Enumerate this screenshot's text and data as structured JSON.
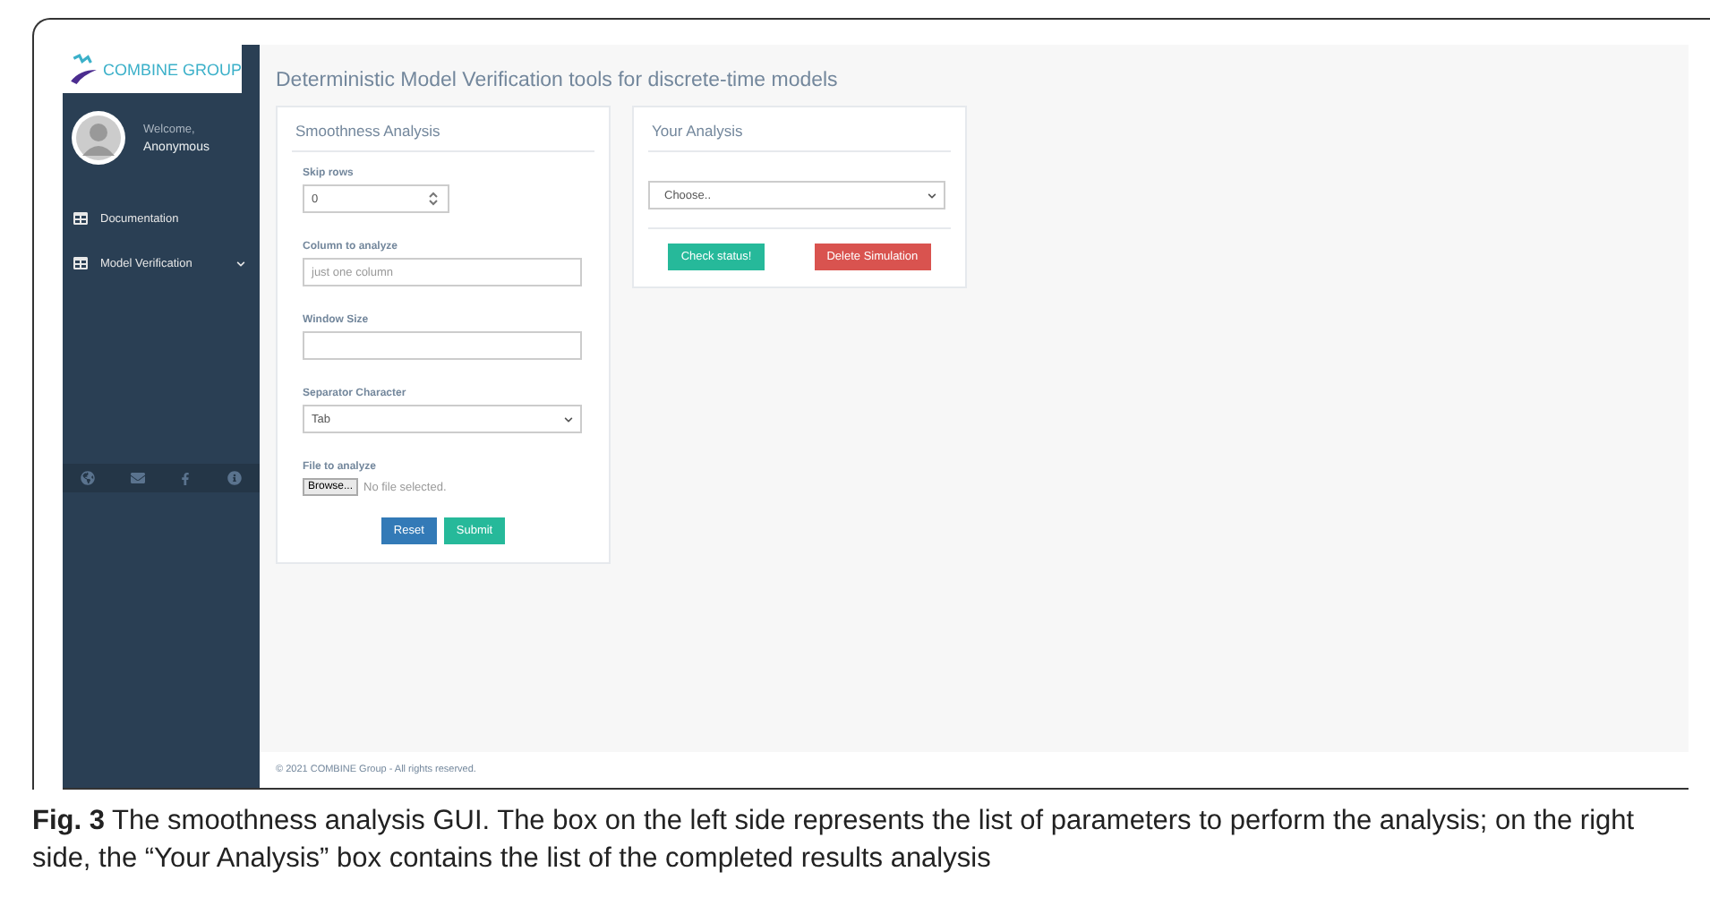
{
  "logo": {
    "text": "COMBINE GROUP"
  },
  "user": {
    "greeting": "Welcome,",
    "name": "Anonymous"
  },
  "sidebar": {
    "items": [
      {
        "label": "Documentation",
        "has_submenu": false
      },
      {
        "label": "Model Verification",
        "has_submenu": true
      }
    ]
  },
  "page_title": "Deterministic Model Verification tools for discrete-time models",
  "smoothness_panel": {
    "title": "Smoothness Analysis",
    "fields": [
      {
        "kind": "number",
        "label": "Skip rows",
        "value": "0"
      },
      {
        "kind": "text",
        "label": "Column to analyze",
        "placeholder": "just one column"
      },
      {
        "kind": "text",
        "label": "Window Size"
      },
      {
        "kind": "select",
        "label": "Separator Character",
        "value": "Tab"
      },
      {
        "kind": "file",
        "label": "File to analyze",
        "button": "Browse...",
        "status": "No file selected."
      }
    ],
    "buttons": [
      {
        "label": "Reset",
        "kind": "primary"
      },
      {
        "label": "Submit",
        "kind": "success"
      }
    ]
  },
  "analysis_panel": {
    "title": "Your Analysis",
    "select": {
      "value": "Choose.."
    },
    "buttons": [
      {
        "label": "Check status!",
        "kind": "success"
      },
      {
        "label": "Delete Simulation",
        "kind": "danger"
      }
    ]
  },
  "footer": "© 2021 COMBINE Group - All rights reserved.",
  "caption": "**Fig. 3**  The smoothness analysis GUI. The box on the left side represents the list of parameters to perform the analysis; on the right side, the “Your Analysis” box contains the list of the completed results analysis"
}
